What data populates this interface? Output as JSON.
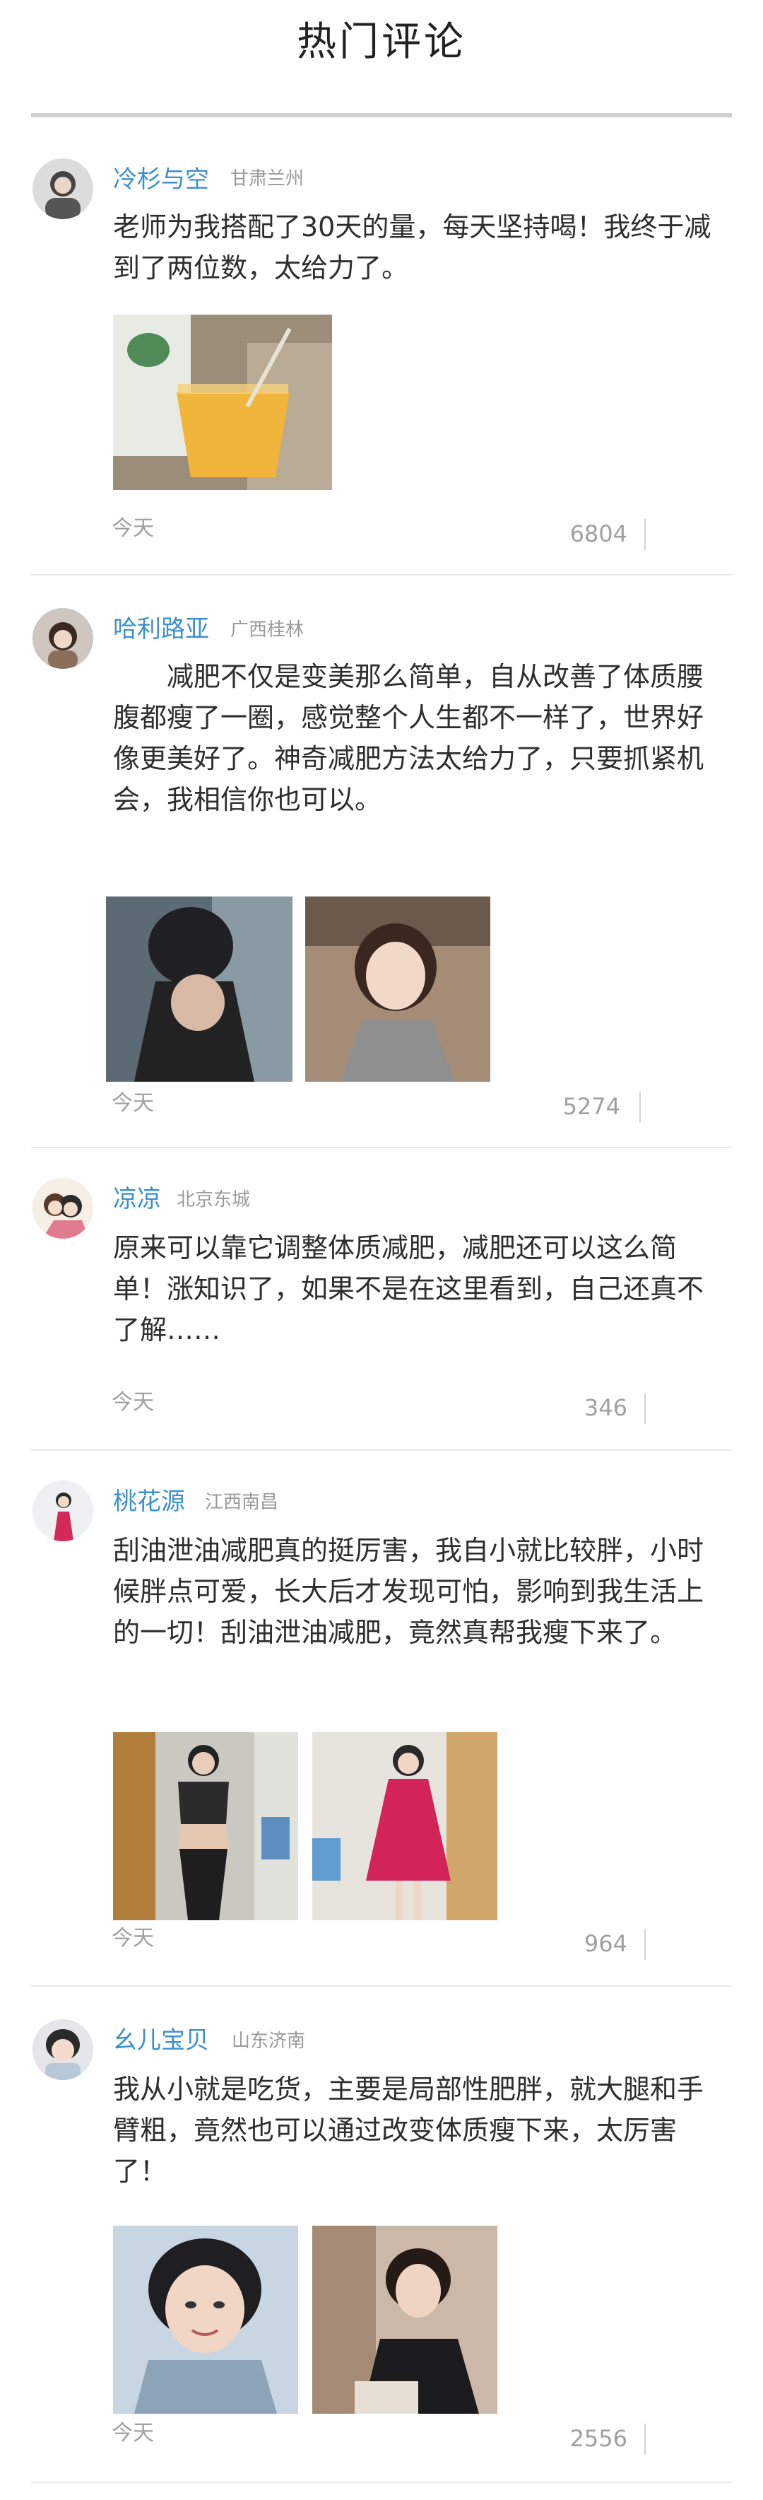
{
  "header": {
    "title": "热门评论"
  },
  "comments": [
    {
      "username": "冷杉与空",
      "location": "甘肃兰州",
      "text": "老师为我搭配了30天的量，每天坚持喝！我终于减到了两位数，太给力了。",
      "time": "今天",
      "likes": "6804"
    },
    {
      "username": "哈利路亚",
      "location": "广西桂林",
      "text": "　　减肥不仅是变美那么简单，自从改善了体质腰腹都瘦了一圈，感觉整个人生都不一样了，世界好像更美好了。神奇减肥方法太给力了，只要抓紧机会，我相信你也可以。",
      "time": "今天",
      "likes": "5274"
    },
    {
      "username": "凉凉",
      "location": "北京东城",
      "text": "原来可以靠它调整体质减肥，减肥还可以这么简单！涨知识了，如果不是在这里看到，自己还真不了解……",
      "time": "今天",
      "likes": "346"
    },
    {
      "username": "桃花源",
      "location": "江西南昌",
      "text": "刮油泄油减肥真的挺厉害，我自小就比较胖，小时候胖点可爱，长大后才发现可怕，影响到我生活上的一切！刮油泄油减肥，竟然真帮我瘦下来了。",
      "time": "今天",
      "likes": "964"
    },
    {
      "username": "幺儿宝贝",
      "location": "山东济南",
      "text": "我从小就是吃货，主要是局部性肥胖，就大腿和手臂粗，竟然也可以通过改变体质瘦下来，太厉害了！",
      "time": "今天",
      "likes": "2556"
    }
  ]
}
